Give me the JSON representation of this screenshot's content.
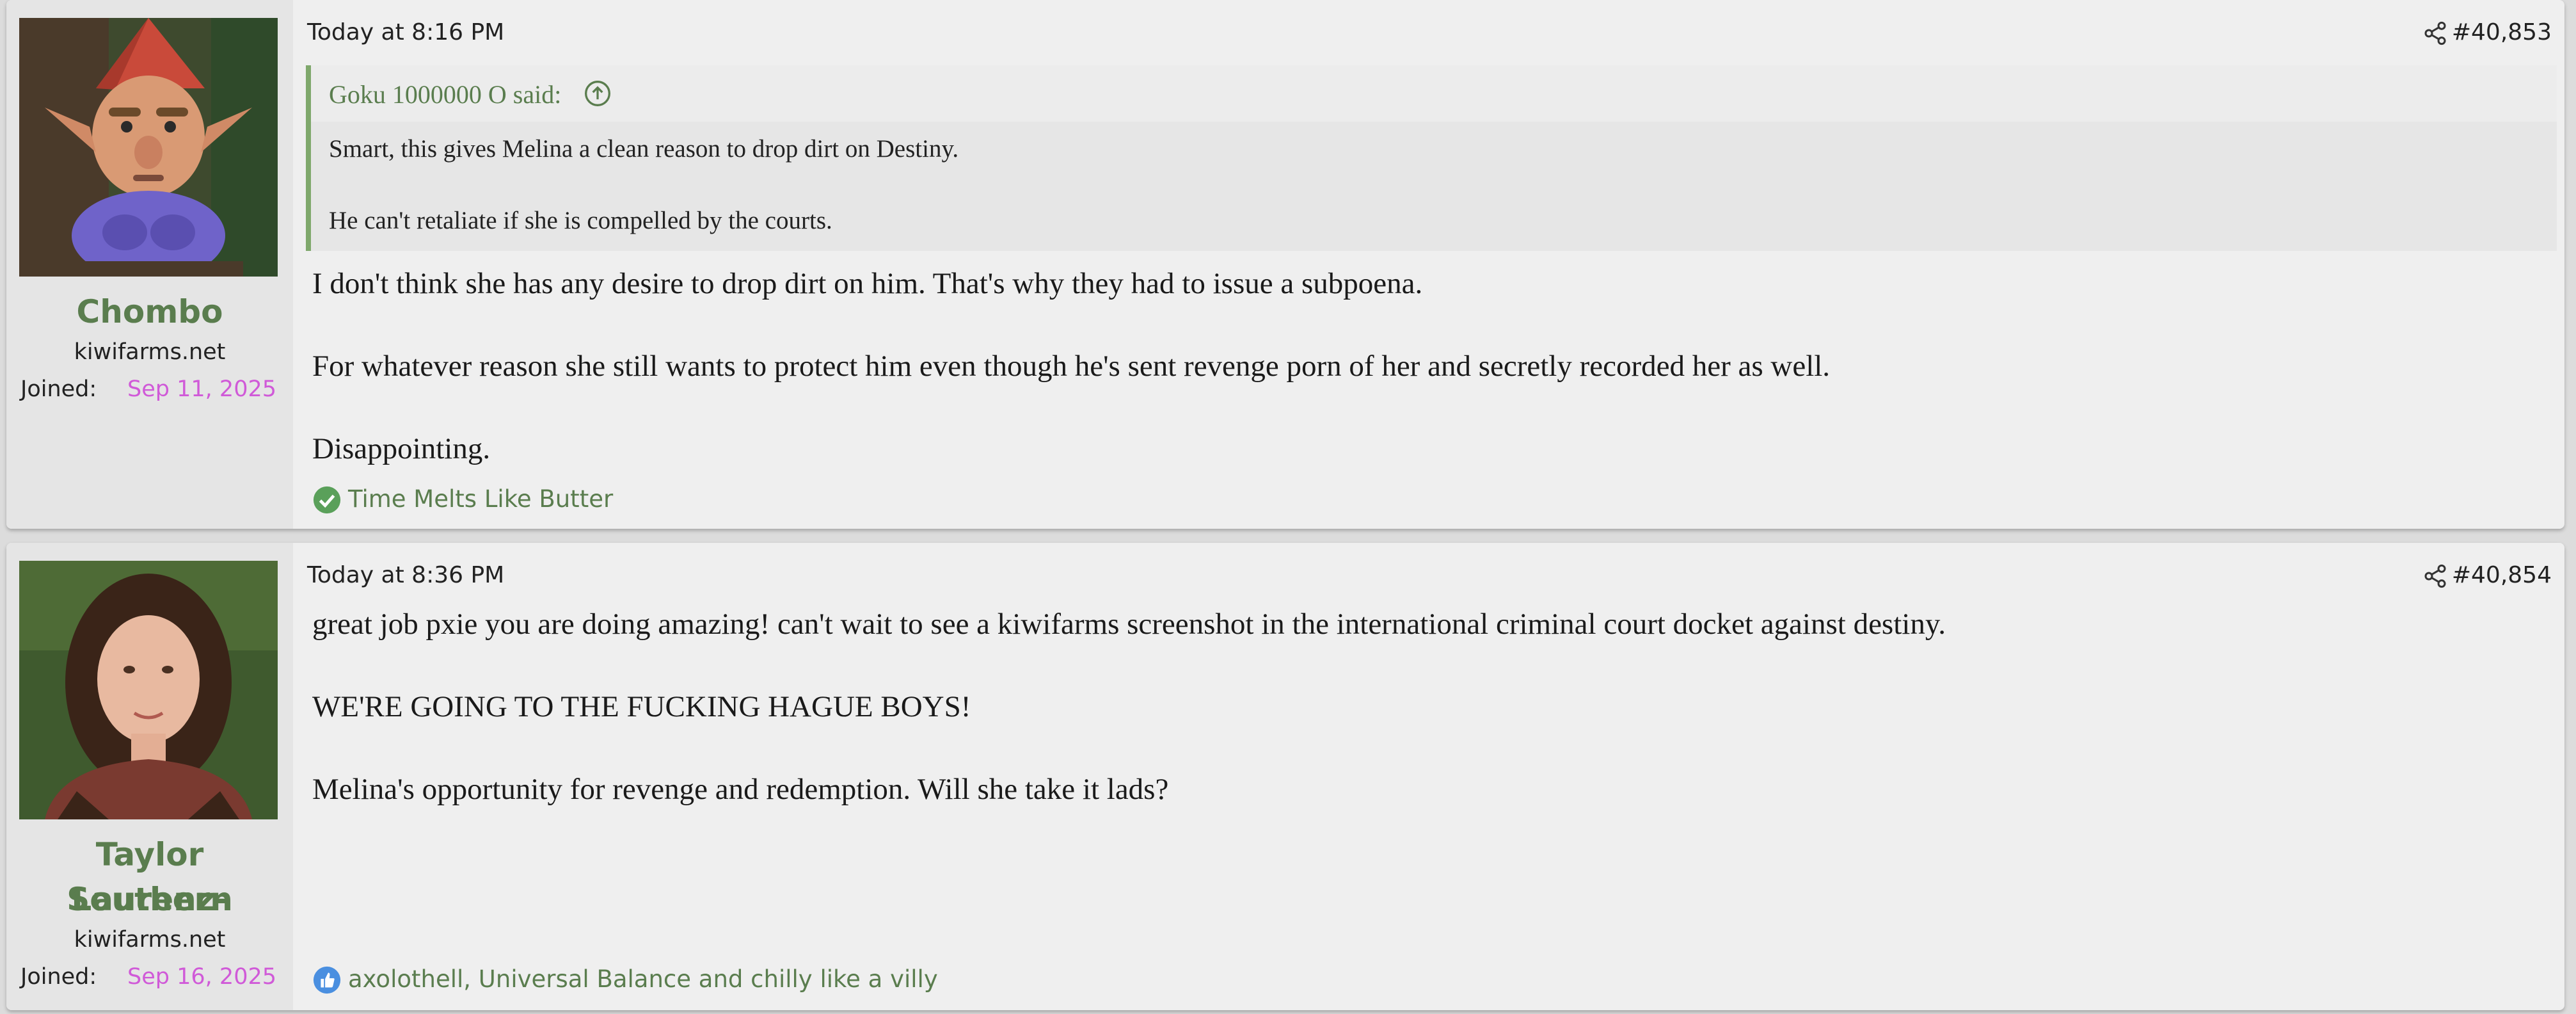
{
  "posts": [
    {
      "user": {
        "name": "Chombo",
        "site": "kiwifarms.net",
        "joined_label": "Joined:",
        "joined_date": "Sep 11, 2025"
      },
      "timestamp": "Today at 8:16 PM",
      "post_number": "#40,853",
      "quote": {
        "author": "Goku 1000000 O said:",
        "lines": [
          "Smart, this gives Melina a clean reason to drop dirt on Destiny.",
          "He can't retaliate if she is compelled by the courts."
        ]
      },
      "body": [
        "I don't think she has any desire to drop dirt on him. That's why they had to issue a subpoena.",
        "For whatever reason she still wants to protect him even though he's sent revenge porn of her and secretly recorded her as well.",
        "Disappointing."
      ],
      "reactions": {
        "icon": "check-circle-icon",
        "text": "Time Melts Like Butter"
      }
    },
    {
      "user": {
        "name_line1": "Taylor Laurenz-",
        "name_line2": "Southern",
        "site": "kiwifarms.net",
        "joined_label": "Joined:",
        "joined_date": "Sep 16, 2025"
      },
      "timestamp": "Today at 8:36 PM",
      "post_number": "#40,854",
      "body": [
        "great job pxie you are doing amazing! can't wait to see a kiwifarms screenshot in the international criminal court docket against destiny.",
        "WE'RE GOING TO THE FUCKING HAGUE BOYS!",
        "Melina's opportunity for revenge and redemption. Will she take it lads?"
      ],
      "reactions": {
        "icon": "thumbs-up-icon",
        "text": "axolothell, Universal Balance and chilly like a villy"
      }
    }
  ],
  "colors": {
    "accent_green": "#5a7d4e",
    "joined_date": "#d05ad8",
    "quote_bar": "#7fa86c"
  }
}
